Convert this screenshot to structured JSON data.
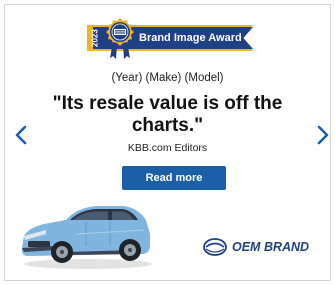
{
  "award": {
    "year": "2023",
    "seal_text": "KELLEY BLUE BOOK",
    "label": "Brand Image Award"
  },
  "ad": {
    "vehicle": "(Year) (Make) (Model)",
    "headline": "\"Its resale value is off the charts.\"",
    "attribution": "KBB.com Editors",
    "cta_label": "Read more"
  },
  "navigation": {
    "prev_icon": "chevron-left-icon",
    "next_icon": "chevron-right-icon"
  },
  "brand": {
    "name": "OEM BRAND",
    "logo_icon": "brand-logo-icon"
  },
  "colors": {
    "brand_blue": "#1f3f86",
    "gold": "#f0b323",
    "cta_blue": "#1b5fa8",
    "arrow_blue": "#1b5fa8",
    "car_body": "#7fb5de"
  }
}
